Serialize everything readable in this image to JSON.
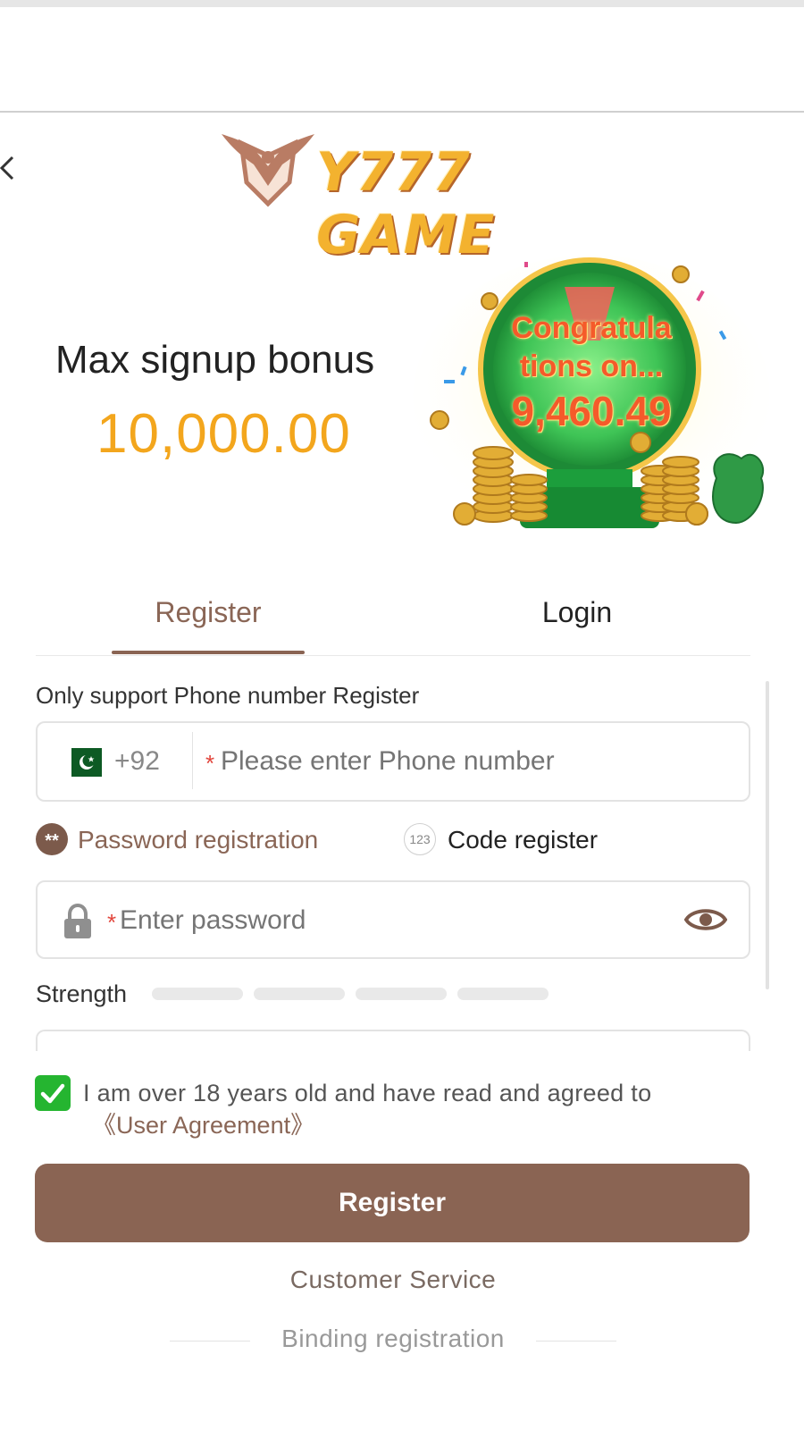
{
  "header": {
    "logo_text": "Y777 GAME"
  },
  "banner": {
    "bonus_title": "Max signup bonus",
    "bonus_amount": "10,000.00",
    "wheel_line1": "Congratula",
    "wheel_line2": "tions on...",
    "wheel_amount": "9,460.49"
  },
  "tabs": [
    {
      "label": "Register",
      "active": true
    },
    {
      "label": "Login",
      "active": false
    }
  ],
  "form": {
    "support_label": "Only support Phone number Register",
    "country_code": "+92",
    "phone_placeholder": "Please enter Phone number",
    "modes": {
      "password_icon": "**",
      "password_label": "Password registration",
      "code_icon": "123",
      "code_label": "Code register"
    },
    "password_placeholder": "Enter password",
    "strength_label": "Strength",
    "agree_text": "I am over 18 years old and have read and agreed to",
    "agreement_link": "《User Agreement》",
    "agree_checked": true,
    "register_button": "Register"
  },
  "footer": {
    "customer_service": "Customer Service",
    "binding_registration": "Binding registration"
  },
  "colors": {
    "brand_brown": "#8a6453",
    "accent_gold": "#f3a61d",
    "check_green": "#25b530",
    "required_red": "#e2453c"
  },
  "icons": [
    "back-arrow-icon",
    "eagle-shield-icon",
    "pakistan-flag-icon",
    "lock-icon",
    "eye-icon",
    "password-mode-icon",
    "code-mode-icon",
    "checkmark-icon"
  ]
}
